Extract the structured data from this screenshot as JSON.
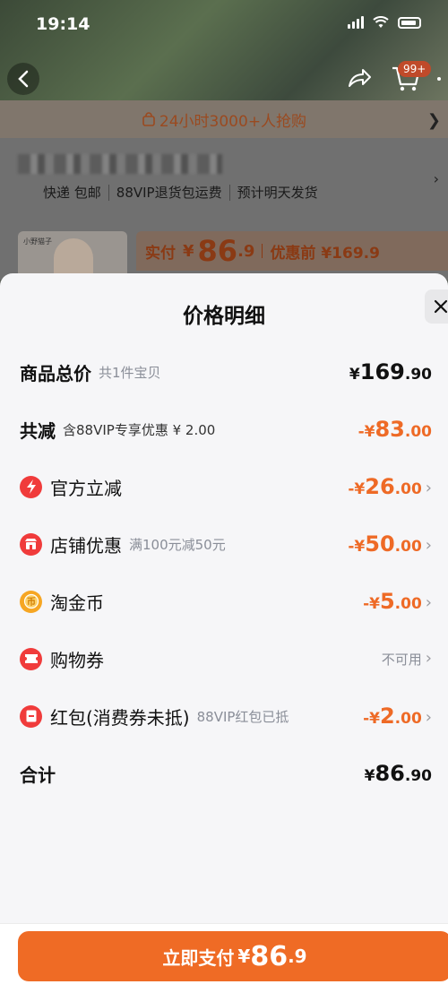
{
  "status_bar": {
    "time": "19:14"
  },
  "nav": {
    "cart_badge": "99+"
  },
  "promo": {
    "text": "24小时3000+人抢购"
  },
  "shipping": {
    "tags": [
      "快递 包邮",
      "88VIP退货包运费",
      "预计明天发货"
    ]
  },
  "thumbnail": {
    "brand_text": "小野猫子"
  },
  "price_bar": {
    "label": "实付",
    "currency": "¥",
    "int": "86",
    "dec": ".9",
    "original": "优惠前 ¥169.9"
  },
  "sheet": {
    "title": "价格明细",
    "rows": [
      {
        "label": "商品总价",
        "note": "共1件宝贝",
        "cur": "¥",
        "int": "169",
        "dec": ".90",
        "color": "#111111"
      },
      {
        "label": "共减",
        "note": "含88VIP专享优惠 ¥ 2.00",
        "cur": "-¥",
        "int": "83",
        "dec": ".00",
        "color": "#ee6a26"
      },
      {
        "label": "官方立减",
        "note": "",
        "cur": "-¥",
        "int": "26",
        "dec": ".00",
        "color": "#ee6a26",
        "icon": "lightning-icon",
        "icon_color": "#f03b3b"
      },
      {
        "label": "店铺优惠",
        "note": "满100元减50元",
        "cur": "-¥",
        "int": "50",
        "dec": ".00",
        "color": "#ee6a26",
        "icon": "store-icon",
        "icon_color": "#f03b3b"
      },
      {
        "label": "淘金币",
        "note": "",
        "cur": "-¥",
        "int": "5",
        "dec": ".00",
        "color": "#ee6a26",
        "icon": "coin-icon",
        "icon_color": "#f6a623"
      },
      {
        "label": "购物券",
        "note": "",
        "status": "不可用",
        "icon": "ticket-icon",
        "icon_color": "#f03b3b"
      },
      {
        "label": "红包(消费券未抵)",
        "note": "88VIP红包已抵",
        "cur": "-¥",
        "int": "2",
        "dec": ".00",
        "color": "#ee6a26",
        "icon": "red-packet-icon",
        "icon_color": "#f03b3b"
      },
      {
        "label": "合计",
        "note": "",
        "cur": "¥",
        "int": "86",
        "dec": ".90",
        "color": "#111111"
      }
    ]
  },
  "footer": {
    "pay_label": "立即支付",
    "pay_currency": "¥",
    "pay_int": "86",
    "pay_dec": ".9",
    "button_color": "#ef6b25"
  }
}
